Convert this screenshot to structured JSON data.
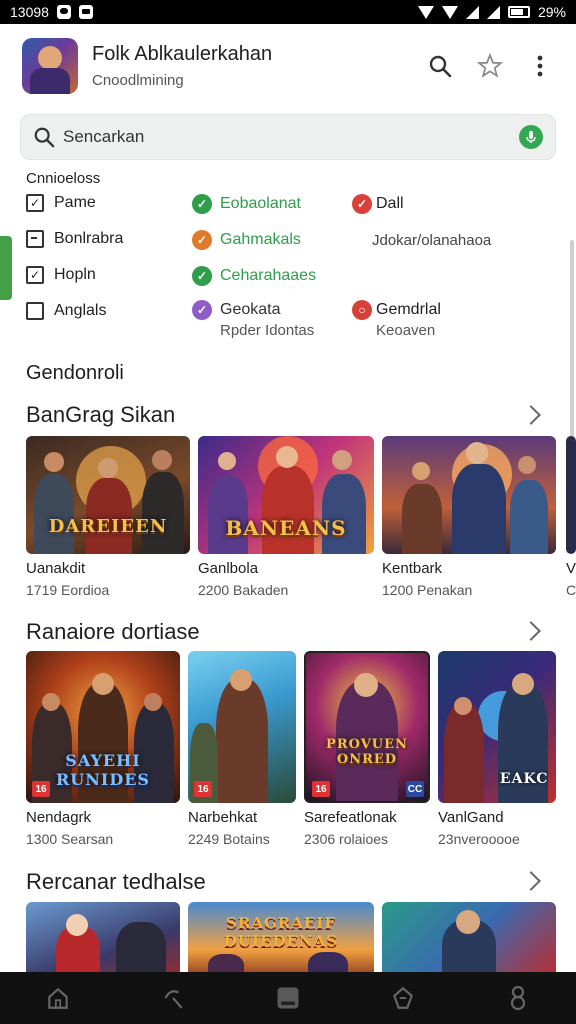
{
  "status_bar": {
    "time": "13098",
    "battery": "29%"
  },
  "header": {
    "title": "Folk Ablkaulerkahan",
    "subtitle": "Cnoodlmining"
  },
  "search": {
    "placeholder": "Sencarkan"
  },
  "filters": {
    "heading": "Cnnioeloss",
    "checkboxes": [
      {
        "label": "Pame",
        "checked": true
      },
      {
        "label": "Bonlrabra",
        "checked": false
      },
      {
        "label": "Hopln",
        "checked": true
      },
      {
        "label": "Anglals",
        "checked": false
      }
    ],
    "statuses": [
      {
        "label": "Eobaolanat",
        "color": "#2e9e4a"
      },
      {
        "label": "Gahmakals",
        "color": "#e07a2a"
      },
      {
        "label": "Ceharahaaes",
        "color": "#2e9e4a"
      },
      {
        "label": "Geokata",
        "sub": "Rpder Idontas",
        "color": "#8e5cc8"
      }
    ],
    "extras": [
      {
        "label": "Dall",
        "color": "#d8413a"
      },
      {
        "label": "Jdokar/olanahaoa"
      },
      {
        "label": "Gemdrlal",
        "sub": "Keoaven",
        "color": "#d8413a"
      }
    ]
  },
  "general_label": "Gendonroli",
  "sections": [
    {
      "title": "BanGrag Sikan",
      "cards": [
        {
          "title": "Uanakdit",
          "meta": "1719 Eordioa",
          "banner": "DAREIEEN"
        },
        {
          "title": "Ganlbola",
          "meta": "2200 Bakaden",
          "banner": "BANEANS"
        },
        {
          "title": "Kentbark",
          "meta": "1200 Penakan",
          "banner": ""
        },
        {
          "title": "V",
          "meta": "C",
          "banner": ""
        }
      ]
    },
    {
      "title": "Ranaiore dortiase",
      "cards": [
        {
          "title": "Nendagrk",
          "meta": "1300 Searsan",
          "banner": "SAYEHI RUNIDES",
          "badge": "16"
        },
        {
          "title": "Narbehkat",
          "meta": "2249 Botains",
          "banner": "",
          "badge": "16"
        },
        {
          "title": "Sarefeatlonak",
          "meta": "2306 rolaioes",
          "banner": "PROVUEN ONRED",
          "badge": "16",
          "badge2": "CC"
        },
        {
          "title": "VanlGand",
          "meta": "23nverooooe",
          "banner": "EAKC"
        }
      ]
    },
    {
      "title": "Rercanar tedhalse",
      "cards": [
        {
          "title": "",
          "meta": "",
          "banner": ""
        },
        {
          "title": "",
          "meta": "",
          "banner": "SRAGRAEIF DUIEDENAS"
        },
        {
          "title": "",
          "meta": "",
          "banner": ""
        }
      ]
    }
  ],
  "colors": {
    "accent_green": "#2e9e4a",
    "nav_bg": "#111111"
  },
  "bottom_nav": [
    "home-icon",
    "back-icon",
    "tab-icon",
    "layers-icon",
    "profile-icon"
  ]
}
